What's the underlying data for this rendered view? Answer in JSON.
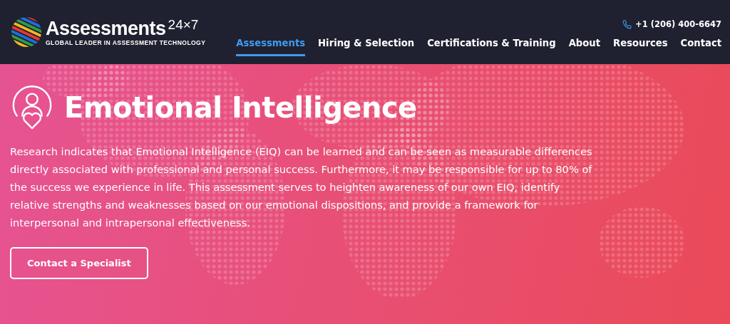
{
  "header": {
    "logo": {
      "name": "Assessments",
      "suffix": "24×7",
      "tagline": "GLOBAL LEADER IN ASSESSMENT TECHNOLOGY"
    },
    "phone": "+1 (206) 400-6647",
    "nav": [
      {
        "label": "Assessments",
        "selected": true
      },
      {
        "label": "Hiring & Selection",
        "selected": false
      },
      {
        "label": "Certifications & Training",
        "selected": false
      },
      {
        "label": "About",
        "selected": false
      },
      {
        "label": "Resources",
        "selected": false
      },
      {
        "label": "Contact",
        "selected": false
      }
    ]
  },
  "hero": {
    "title": "Emotional Intelligence",
    "body": "Research indicates that Emotional Intelligence (EIQ) can be learned and can be seen as measurable differences directly associated with professional and personal success. Furthermore, it may be responsible for up to 80% of the success we experience in life. This assessment serves to heighten awareness of our own EIQ, identify relative strengths and weaknesses based on our emotional dispositions, and provide a framework for interpersonal and intrapersonal effectiveness.",
    "button": "Contact a Specialist"
  }
}
